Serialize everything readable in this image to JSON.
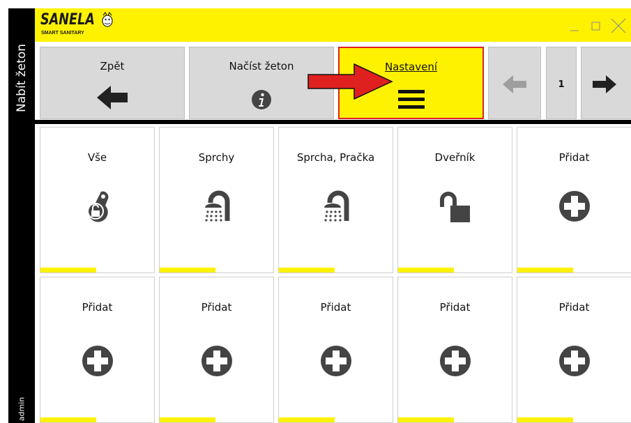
{
  "sidebar": {
    "top_label": "Nabít žeton",
    "bottom_label": "admin"
  },
  "titlebar": {
    "logo_text": "SANELA",
    "logo_tagline": "SMART SANITARY"
  },
  "toolbar": {
    "back_label": "Zpět",
    "load_token_label": "Načíst žeton",
    "settings_label": "Nastavení",
    "page_number": "1"
  },
  "tiles": [
    {
      "label": "Vše",
      "icon": "key-fob-icon"
    },
    {
      "label": "Sprchy",
      "icon": "shower-icon"
    },
    {
      "label": "Sprcha, Pračka",
      "icon": "shower-icon"
    },
    {
      "label": "Dveřník",
      "icon": "unlocked-padlock-icon"
    },
    {
      "label": "Přidat",
      "icon": "plus-circle-icon"
    },
    {
      "label": "Přidat",
      "icon": "plus-circle-icon"
    },
    {
      "label": "Přidat",
      "icon": "plus-circle-icon"
    },
    {
      "label": "Přidat",
      "icon": "plus-circle-icon"
    },
    {
      "label": "Přidat",
      "icon": "plus-circle-icon"
    },
    {
      "label": "Přidat",
      "icon": "plus-circle-icon"
    }
  ],
  "colors": {
    "accent_yellow": "#fff200",
    "highlight_red": "#e0201e",
    "button_gray": "#d9d9d9",
    "icon_gray": "#444444"
  }
}
